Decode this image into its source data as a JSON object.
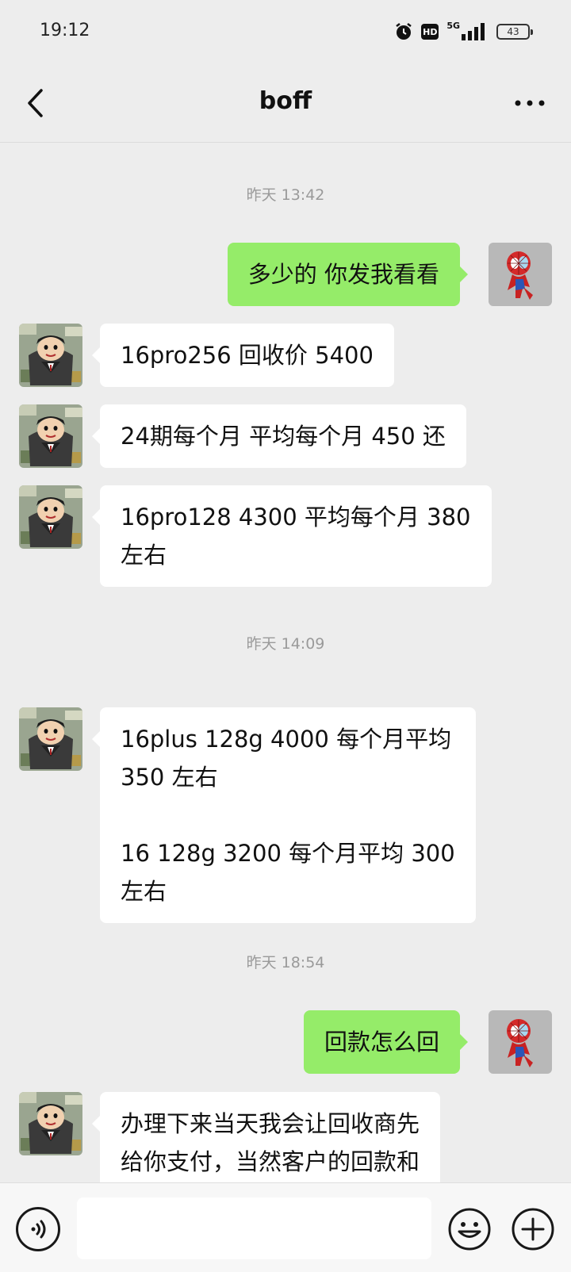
{
  "status_bar": {
    "time": "19:12",
    "network": "5G",
    "hd_label": "HD",
    "battery_level": "43"
  },
  "header": {
    "title": "boff",
    "back_icon": "chevron-left-icon",
    "more_icon": "more-dots-icon"
  },
  "messages": [
    {
      "type": "timestamp",
      "text": "昨天 13:42"
    },
    {
      "type": "outgoing",
      "text": "多少的 你发我看看",
      "avatar": "spiderman-avatar"
    },
    {
      "type": "incoming",
      "text": "16pro256 回收价 5400",
      "avatar": "contact-avatar"
    },
    {
      "type": "incoming",
      "text": "24期每个月 平均每个月 450 还",
      "avatar": "contact-avatar"
    },
    {
      "type": "incoming",
      "text": "16pro128 4300 平均每个月 380\n左右",
      "avatar": "contact-avatar"
    },
    {
      "type": "timestamp",
      "text": "昨天 14:09"
    },
    {
      "type": "incoming",
      "text": "16plus 128g 4000 每个月平均\n350 左右\n\n16 128g 3200 每个月平均 300\n左右",
      "avatar": "contact-avatar"
    },
    {
      "type": "timestamp",
      "text": "昨天 18:54"
    },
    {
      "type": "outgoing",
      "text": "回款怎么回",
      "avatar": "spiderman-avatar"
    },
    {
      "type": "incoming",
      "text": "办理下来当天我会让回收商先\n给你支付，当然客户的回款和",
      "avatar": "contact-avatar"
    }
  ],
  "input_bar": {
    "placeholder": "",
    "value": "",
    "voice_icon": "voice-icon",
    "emoji_icon": "emoji-icon",
    "plus_icon": "plus-icon"
  },
  "colors": {
    "background": "#ededed",
    "outgoing_bubble": "#95ec69",
    "incoming_bubble": "#ffffff",
    "timestamp_text": "#9a9a9a"
  }
}
